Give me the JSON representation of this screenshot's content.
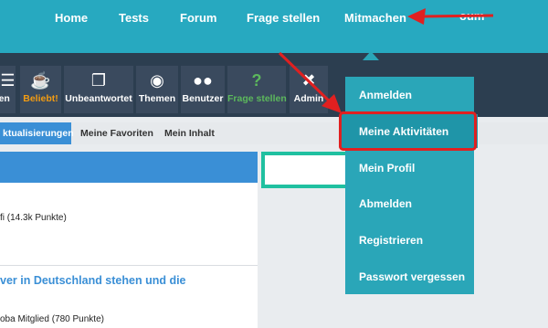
{
  "top_nav": {
    "items": [
      "Home",
      "Tests",
      "Forum",
      "Frage stellen",
      "Mitmachen"
    ],
    "partial_item": "oum"
  },
  "toolbar": {
    "items": [
      {
        "label": "gen",
        "icon": "list-icon"
      },
      {
        "label": "Beliebt!",
        "icon": "coffee-icon"
      },
      {
        "label": "Unbeantwortet",
        "icon": "copy-icon"
      },
      {
        "label": "Themen",
        "icon": "tag-icon"
      },
      {
        "label": "Benutzer",
        "icon": "users-icon"
      },
      {
        "label": "Frage stellen",
        "icon": "question-icon"
      },
      {
        "label": "Admin",
        "icon": "wrench-icon"
      }
    ]
  },
  "subtabs": [
    "ktualisierungen",
    "Meine Favoriten",
    "Mein Inhalt"
  ],
  "content": {
    "meta1": "fi (14.3k Punkte)",
    "question_title": "ver in Deutschland stehen und die",
    "meta2": "oba Mitglied (780 Punkte)"
  },
  "dropdown": {
    "items": [
      "Anmelden",
      "Meine Aktivitäten",
      "Mein Profil",
      "Abmelden",
      "Registrieren",
      "Passwort vergessen"
    ]
  },
  "colors": {
    "topbar": "#27a9c0",
    "toolbar": "#2c3e50",
    "dropdown": "#2aa6b8",
    "highlight_border": "#e02020",
    "link_blue": "#3a8fd6"
  }
}
